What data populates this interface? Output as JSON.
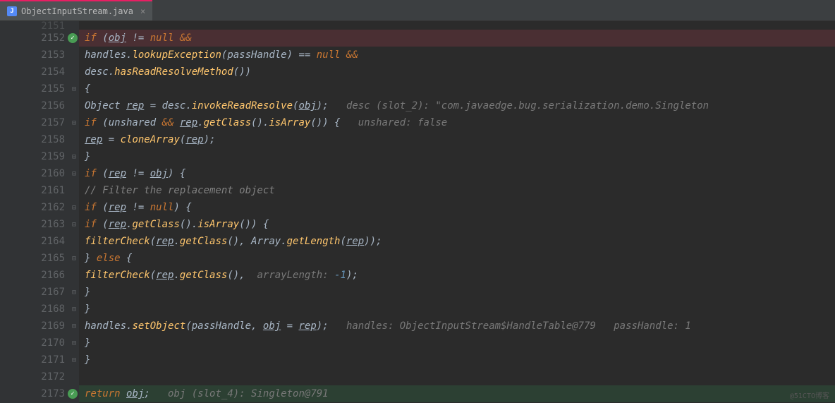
{
  "tab": {
    "filename": "ObjectInputStream.java",
    "icon_letter": "J"
  },
  "lines": {
    "partial_top": "2151",
    "start": 2152,
    "end": 2173
  },
  "gutter": {
    "check_lines": [
      2152,
      2173
    ],
    "fold_lines": [
      2155,
      2157,
      2159,
      2160,
      2162,
      2163,
      2165,
      2167,
      2168,
      2169,
      2170,
      2171
    ]
  },
  "code": {
    "l2152": {
      "kw_if": "if",
      "obj": "obj",
      "ne": "!=",
      "null": "null",
      "and": "&&"
    },
    "l2153": {
      "handles": "handles",
      "method": "lookupException",
      "arg": "passHandle",
      "eq": "==",
      "null": "null",
      "and": "&&"
    },
    "l2154": {
      "desc": "desc",
      "method": "hasReadResolveMethod"
    },
    "l2155": {
      "brace": "{"
    },
    "l2156": {
      "type": "Object",
      "rep": "rep",
      "eq": "=",
      "desc": "desc",
      "method": "invokeReadResolve",
      "obj": "obj",
      "hint": "desc (slot_2): \"com.javaedge.bug.serialization.demo.Singleton"
    },
    "l2157": {
      "kw_if": "if",
      "unshared": "unshared",
      "and": "&&",
      "rep": "rep",
      "m_getclass": "getClass",
      "m_isarray": "isArray",
      "brace": "{",
      "hint": "unshared: false"
    },
    "l2158": {
      "rep": "rep",
      "eq": "=",
      "method": "cloneArray",
      "rep2": "rep"
    },
    "l2159": {
      "brace": "}"
    },
    "l2160": {
      "kw_if": "if",
      "rep": "rep",
      "ne": "!=",
      "obj": "obj",
      "brace": "{"
    },
    "l2161": {
      "comment": "// Filter the replacement object"
    },
    "l2162": {
      "kw_if": "if",
      "rep": "rep",
      "ne": "!=",
      "null": "null",
      "brace": "{"
    },
    "l2163": {
      "kw_if": "if",
      "rep": "rep",
      "m_getclass": "getClass",
      "m_isarray": "isArray",
      "brace": "{"
    },
    "l2164": {
      "method": "filterCheck",
      "rep": "rep",
      "m_getclass": "getClass",
      "cls": "Array",
      "m_getlength": "getLength",
      "rep2": "rep"
    },
    "l2165": {
      "brace_c": "}",
      "kw_else": "else",
      "brace_o": "{"
    },
    "l2166": {
      "method": "filterCheck",
      "rep": "rep",
      "m_getclass": "getClass",
      "hint": "arrayLength:",
      "neg1": "-1"
    },
    "l2167": {
      "brace": "}"
    },
    "l2168": {
      "brace": "}"
    },
    "l2169": {
      "handles": "handles",
      "method": "setObject",
      "arg": "passHandle",
      "obj": "obj",
      "eq": "=",
      "rep": "rep",
      "hint": "handles: ObjectInputStream$HandleTable@779   passHandle: 1"
    },
    "l2170": {
      "brace": "}"
    },
    "l2171": {
      "brace": "}"
    },
    "l2173": {
      "kw_return": "return",
      "obj": "obj",
      "hint": "obj (slot_4): Singleton@791"
    }
  },
  "watermark": "@51CTO博客"
}
